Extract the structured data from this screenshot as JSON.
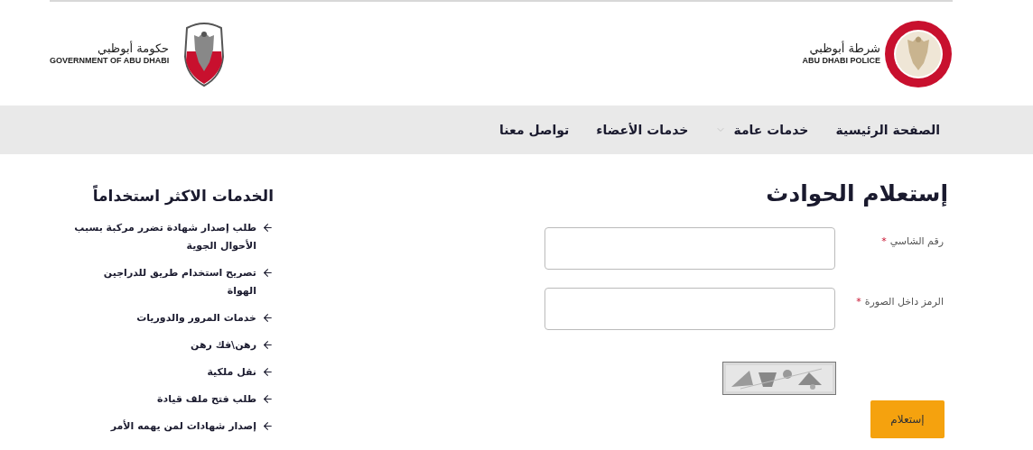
{
  "header": {
    "police_logo": {
      "arabic": "شرطة أبوظبي",
      "english": "ABU DHABI POLICE"
    },
    "government_logo": {
      "arabic": "حكومة أبوظبي",
      "english": "GOVERNMENT OF ABU DHABI"
    }
  },
  "nav": {
    "items": [
      {
        "label": "الصفحة الرئيسية",
        "has_dropdown": false
      },
      {
        "label": "خدمات عامة",
        "has_dropdown": true
      },
      {
        "label": "خدمات الأعضاء",
        "has_dropdown": false
      },
      {
        "label": "تواصل معنا",
        "has_dropdown": false
      }
    ]
  },
  "form": {
    "title": "إستعلام الحوادث",
    "fields": [
      {
        "label": "رقم الشاسي",
        "required_mark": "*"
      },
      {
        "label": "الرمز داخل الصورة",
        "required_mark": "*"
      }
    ],
    "submit": "إستعلام"
  },
  "sidebar": {
    "title": "الخدمات الاكثر استخداماً",
    "items": [
      "طلب إصدار شهادة تضرر مركبة بسبب الأحوال الجوية",
      "تصريح استخدام طريق للدراجين الهواة",
      "خدمات المرور والدوريات",
      "رهن\\فك رهن",
      "نقل ملكية",
      "طلب فتح ملف قيادة",
      "إصدار شهادات لمن يهمه الأمر"
    ]
  }
}
